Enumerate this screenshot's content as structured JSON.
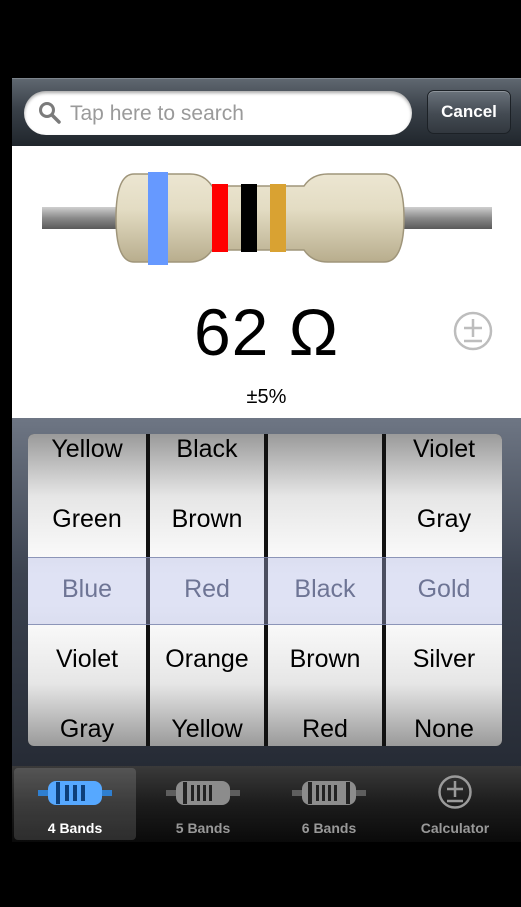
{
  "search": {
    "placeholder": "Tap here to search",
    "cancel_label": "Cancel"
  },
  "resistor": {
    "bands": [
      {
        "color": "Blue",
        "hex": "#6699ff"
      },
      {
        "color": "Red",
        "hex": "#ff0000"
      },
      {
        "color": "Black",
        "hex": "#000000"
      },
      {
        "color": "Gold",
        "hex": "#d9a232"
      }
    ]
  },
  "display": {
    "value": "62 Ω",
    "tolerance": "±5%"
  },
  "picker": {
    "columns": [
      {
        "items": [
          "Yellow",
          "Green",
          "Blue",
          "Violet",
          "Gray"
        ],
        "selected": "Blue"
      },
      {
        "items": [
          "Black",
          "Brown",
          "Red",
          "Orange",
          "Yellow"
        ],
        "selected": "Red"
      },
      {
        "items": [
          "",
          "",
          "Black",
          "Brown",
          "Red"
        ],
        "selected": "Black"
      },
      {
        "items": [
          "Violet",
          "Gray",
          "Gold",
          "Silver",
          "None"
        ],
        "selected": "Gold"
      }
    ]
  },
  "tabs": [
    {
      "label": "4 Bands",
      "icon": "resistor-4-band-icon",
      "active": true
    },
    {
      "label": "5 Bands",
      "icon": "resistor-5-band-icon",
      "active": false
    },
    {
      "label": "6 Bands",
      "icon": "resistor-6-band-icon",
      "active": false
    },
    {
      "label": "Calculator",
      "icon": "plus-minus-icon",
      "active": false
    }
  ],
  "colors": {
    "accent": "#4a90e2",
    "tab_active_icon": "#3a8fe0"
  }
}
